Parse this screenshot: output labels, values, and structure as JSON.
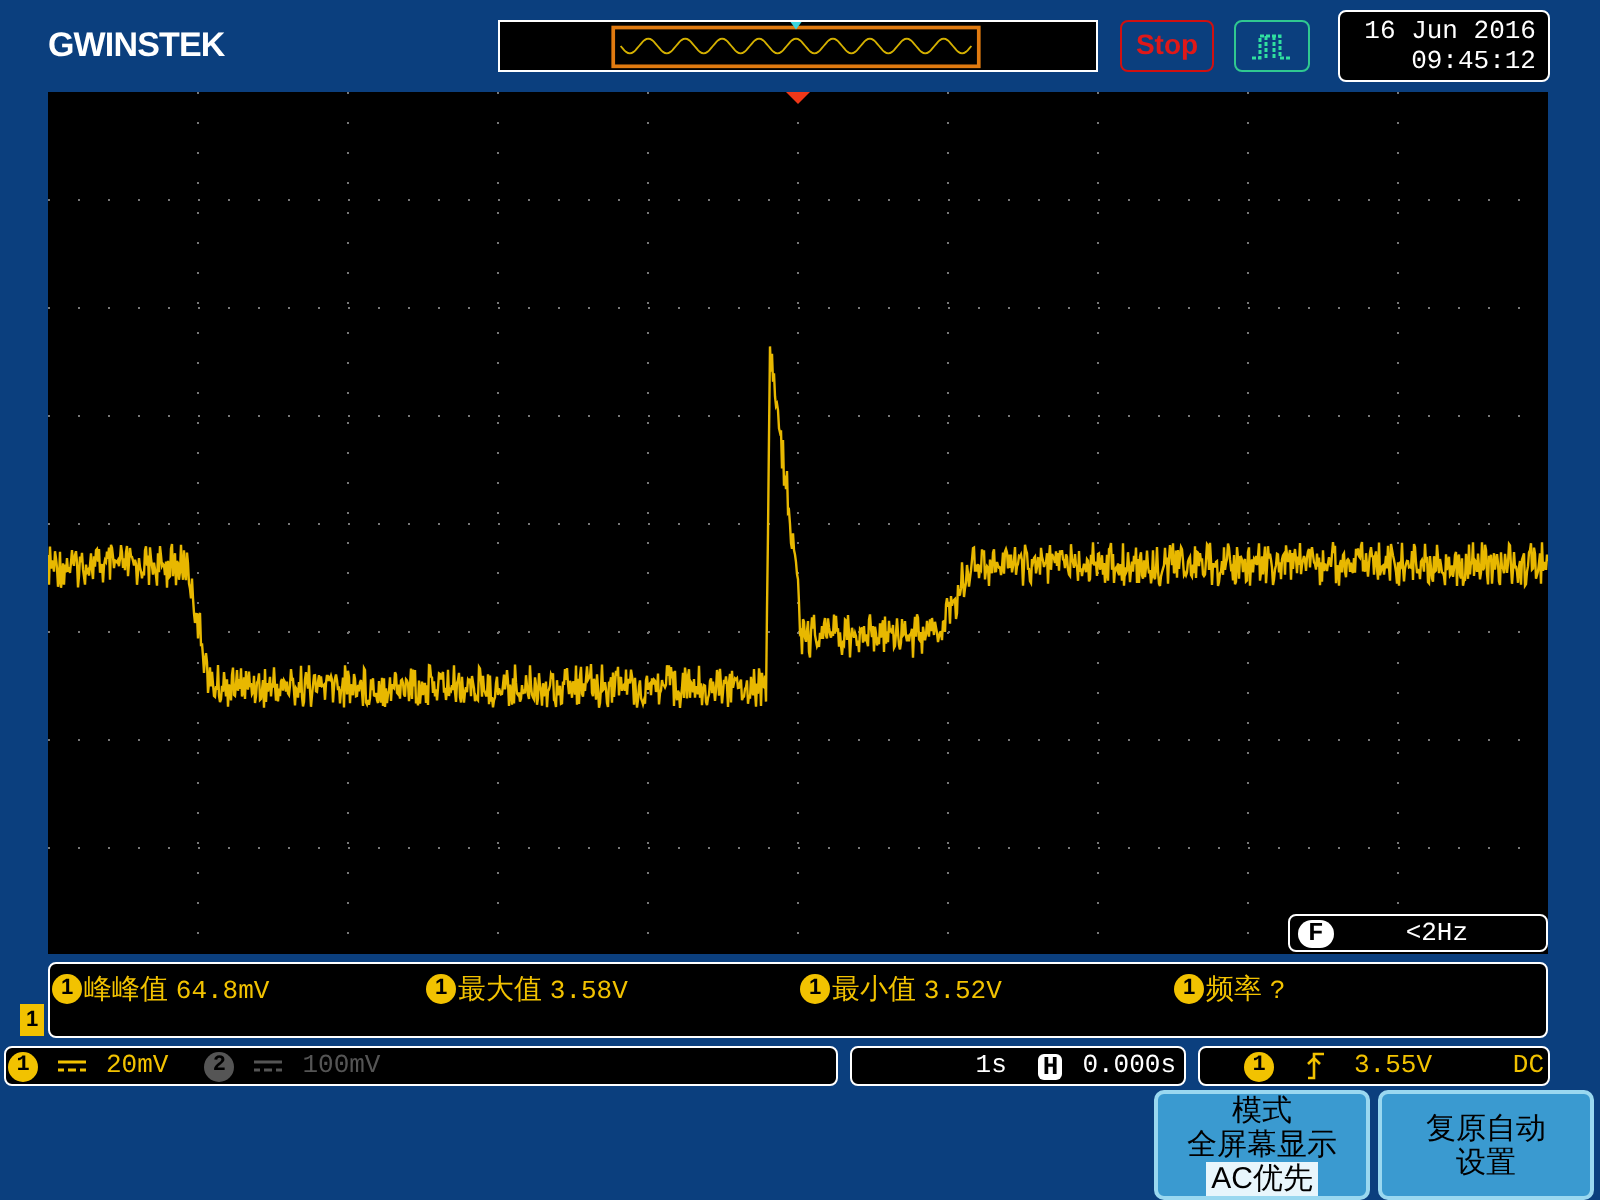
{
  "header": {
    "brand": "GWINSTEK",
    "status": "Stop",
    "date": "16 Jun 2016",
    "time": "09:45:12"
  },
  "counter": {
    "label": "F",
    "reading": "<2Hz"
  },
  "channel_marker": "1",
  "measurements": [
    {
      "channel": "1",
      "label": "峰峰值",
      "value": "64.8mV"
    },
    {
      "channel": "1",
      "label": "最大值",
      "value": "3.58V"
    },
    {
      "channel": "1",
      "label": "最小值",
      "value": "3.52V"
    },
    {
      "channel": "1",
      "label": "频率",
      "value": "?"
    }
  ],
  "channels": [
    {
      "number": "1",
      "scale": "20mV",
      "enabled": true
    },
    {
      "number": "2",
      "scale": "100mV",
      "enabled": false
    }
  ],
  "timebase": {
    "scale": "1s",
    "position_label": "H",
    "position": "0.000s"
  },
  "trigger": {
    "source": "1",
    "level": "3.55V",
    "coupling": "DC"
  },
  "softkeys": [
    {
      "lines": [
        "模式",
        "全屏幕显示"
      ],
      "option": "AC优先"
    },
    {
      "lines": [
        "复原自动",
        "设置"
      ]
    }
  ]
}
